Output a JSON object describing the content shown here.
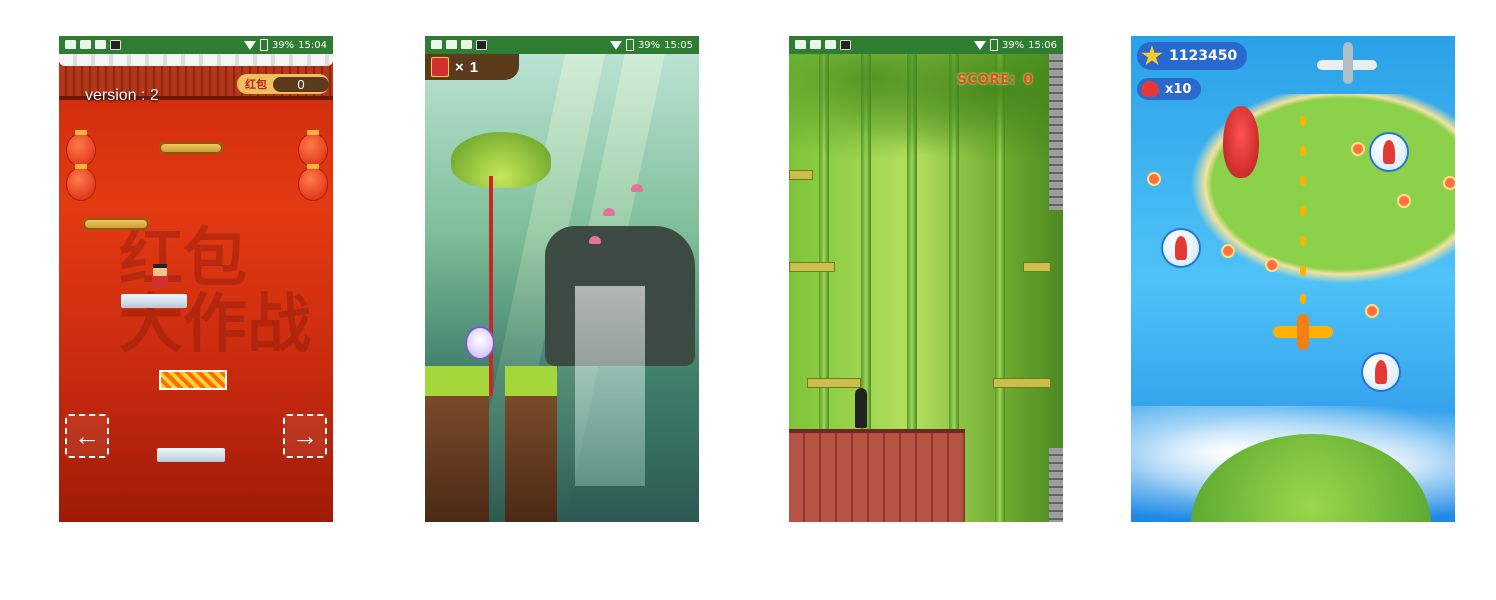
{
  "screens": [
    {
      "status": {
        "battery": "39%",
        "time": "15:04"
      },
      "version_label": "version : 2",
      "hongbao_label": "红包",
      "hongbao_count": "0",
      "watermark": "红包\n大作战"
    },
    {
      "status": {
        "battery": "39%",
        "time": "15:05"
      },
      "hud_multiplier": "×",
      "hud_count": "1"
    },
    {
      "status": {
        "battery": "39%",
        "time": "15:06"
      },
      "score_label": "SCORE:",
      "score_value": "0"
    },
    {
      "coins": "1123450",
      "lives": "x10"
    }
  ],
  "icons": [
    "statusbar-icons",
    "wifi-icon",
    "battery-icon",
    "left-arrow-icon",
    "right-arrow-icon",
    "red-envelope-icon",
    "star-icon",
    "heart-icon"
  ]
}
